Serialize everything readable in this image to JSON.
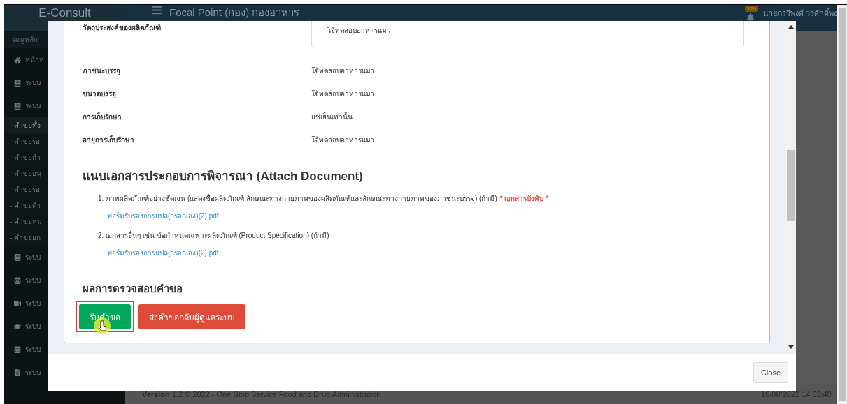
{
  "header": {
    "brand": "E-Consult",
    "title": "Focal Point (กอง) กองอาหาร",
    "notification_count": "126",
    "user": "นายภรวีพงศ์ วรศักดิ์พง"
  },
  "sidebar": {
    "heading": "เมนูหลัก",
    "items": [
      {
        "label": "หน้าห",
        "kind": "home"
      },
      {
        "label": "ระบบ",
        "kind": "book"
      },
      {
        "label": "ระบบ",
        "kind": "book"
      },
      {
        "label": "- คำขอทั้ง",
        "kind": "sub",
        "selected": true
      },
      {
        "label": "- คำขอรอ",
        "kind": "sub",
        "selected": false
      },
      {
        "label": "- คำขอกำ",
        "kind": "sub",
        "selected": false
      },
      {
        "label": "- คำขออนุ",
        "kind": "sub",
        "selected": false
      },
      {
        "label": "- คำขอรอ",
        "kind": "sub",
        "selected": false
      },
      {
        "label": "- คำขอดำ",
        "kind": "sub",
        "selected": false
      },
      {
        "label": "- คำขอหม",
        "kind": "sub",
        "selected": false
      },
      {
        "label": "- คำขอยก",
        "kind": "sub",
        "selected": false
      },
      {
        "label": "ระบบ",
        "kind": "book"
      },
      {
        "label": "ระบบ",
        "kind": "calendar"
      },
      {
        "label": "ระบบ",
        "kind": "video"
      },
      {
        "label": "ระบบ",
        "kind": "graduation"
      },
      {
        "label": "ระบบ",
        "kind": "calendar"
      },
      {
        "label": "ระบบ",
        "kind": "file"
      }
    ]
  },
  "footer": {
    "version_label": "Version",
    "text": "1.2 © 2022 - One Stop Service Food and Drug Administration",
    "timestamp": "10/08/2022 14:53:40"
  },
  "modal": {
    "top_field": {
      "label": "วัตถุประสงค์ของผลิตภัณฑ์",
      "value": "โจ้ทดสอบอาหารแมว"
    },
    "fields": [
      {
        "label": "ภาชนะบรรจุ",
        "value": "โจ้ทดสอบอาหารแมว"
      },
      {
        "label": "ขนาดบรรจุ",
        "value": "โจ้ทดสอบอาหารแมว"
      },
      {
        "label": "การเก็บรักษา",
        "value": "แช่เย็นเท่านั้น"
      },
      {
        "label": "อายุการเก็บรักษา",
        "value": "โจ้ทดสอบอาหารแมว"
      }
    ],
    "attach": {
      "title": "แนบเอกสารประกอบการพิจารณา (Attach Document)",
      "documents": [
        {
          "number": "1.",
          "text": "ภาพผลิตภัณฑ์อย่างชัดเจน (แสดงชื่อผลิตภัณฑ์ ลักษณะทางกายภาพของผลิตภัณฑ์และลักษณะทางกายภาพของภาชนะบรรจุ) (ถ้ามี)",
          "required_label": "* เอกสารบังคับ *",
          "file": "ฟอร์มรับรองการแปล(กรอกเอง)(2).pdf"
        },
        {
          "number": "2.",
          "text": "เอกสารอื่นๆ เช่น ข้อกำหนดเฉพาะผลิตภัณฑ์ (Product Specification) (ถ้ามี)",
          "file": "ฟอร์มรับรองการแปล(กรอกเอง)(2).pdf"
        }
      ]
    },
    "review": {
      "title": "ผลการตรวจสอบคำขอ",
      "buttons": [
        {
          "label": "รับคำขอ",
          "kind": "accept",
          "highlighted": true
        },
        {
          "label": "ส่งคำขอกลับผู้ดูแลระบบ",
          "kind": "return",
          "highlighted": false
        }
      ]
    },
    "close": "Close"
  }
}
